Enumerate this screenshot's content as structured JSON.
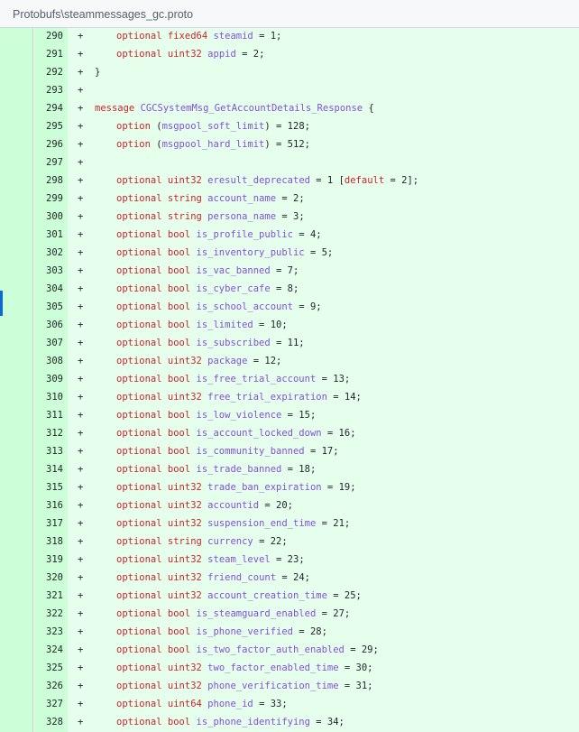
{
  "file": {
    "path": "Protobufs\\steammessages_gc.proto"
  },
  "diff": {
    "marker": "+",
    "lines": [
      {
        "n": "290",
        "indent": true,
        "parts": [
          [
            "kw",
            "optional "
          ],
          [
            "tp",
            "fixed64 "
          ],
          [
            "id",
            "steamid"
          ],
          [
            "p",
            " = 1;"
          ]
        ]
      },
      {
        "n": "291",
        "indent": true,
        "parts": [
          [
            "kw",
            "optional "
          ],
          [
            "tp",
            "uint32 "
          ],
          [
            "id",
            "appid"
          ],
          [
            "p",
            " = 2;"
          ]
        ]
      },
      {
        "n": "292",
        "indent": false,
        "parts": [
          [
            "p",
            "}"
          ]
        ]
      },
      {
        "n": "293",
        "indent": false,
        "parts": []
      },
      {
        "n": "294",
        "indent": false,
        "parts": [
          [
            "kw",
            "message "
          ],
          [
            "id",
            "CGCSystemMsg_GetAccountDetails_Response"
          ],
          [
            "p",
            " {"
          ]
        ]
      },
      {
        "n": "295",
        "indent": true,
        "parts": [
          [
            "kw",
            "option "
          ],
          [
            "p",
            "("
          ],
          [
            "id",
            "msgpool_soft_limit"
          ],
          [
            "p",
            ") = 128;"
          ]
        ]
      },
      {
        "n": "296",
        "indent": true,
        "parts": [
          [
            "kw",
            "option "
          ],
          [
            "p",
            "("
          ],
          [
            "id",
            "msgpool_hard_limit"
          ],
          [
            "p",
            ") = 512;"
          ]
        ]
      },
      {
        "n": "297",
        "indent": false,
        "parts": []
      },
      {
        "n": "298",
        "indent": true,
        "parts": [
          [
            "kw",
            "optional "
          ],
          [
            "tp",
            "uint32 "
          ],
          [
            "id",
            "eresult_deprecated"
          ],
          [
            "p",
            " = 1 ["
          ],
          [
            "kw",
            "default"
          ],
          [
            "p",
            " = 2];"
          ]
        ]
      },
      {
        "n": "299",
        "indent": true,
        "parts": [
          [
            "kw",
            "optional "
          ],
          [
            "tp",
            "string "
          ],
          [
            "id",
            "account_name"
          ],
          [
            "p",
            " = 2;"
          ]
        ]
      },
      {
        "n": "300",
        "indent": true,
        "parts": [
          [
            "kw",
            "optional "
          ],
          [
            "tp",
            "string "
          ],
          [
            "id",
            "persona_name"
          ],
          [
            "p",
            " = 3;"
          ]
        ]
      },
      {
        "n": "301",
        "indent": true,
        "parts": [
          [
            "kw",
            "optional "
          ],
          [
            "tp",
            "bool "
          ],
          [
            "id",
            "is_profile_public"
          ],
          [
            "p",
            " = 4;"
          ]
        ]
      },
      {
        "n": "302",
        "indent": true,
        "parts": [
          [
            "kw",
            "optional "
          ],
          [
            "tp",
            "bool "
          ],
          [
            "id",
            "is_inventory_public"
          ],
          [
            "p",
            " = 5;"
          ]
        ]
      },
      {
        "n": "303",
        "indent": true,
        "parts": [
          [
            "kw",
            "optional "
          ],
          [
            "tp",
            "bool "
          ],
          [
            "id",
            "is_vac_banned"
          ],
          [
            "p",
            " = 7;"
          ]
        ]
      },
      {
        "n": "304",
        "indent": true,
        "parts": [
          [
            "kw",
            "optional "
          ],
          [
            "tp",
            "bool "
          ],
          [
            "id",
            "is_cyber_cafe"
          ],
          [
            "p",
            " = 8;"
          ]
        ]
      },
      {
        "n": "305",
        "indent": true,
        "parts": [
          [
            "kw",
            "optional "
          ],
          [
            "tp",
            "bool "
          ],
          [
            "id",
            "is_school_account"
          ],
          [
            "p",
            " = 9;"
          ]
        ]
      },
      {
        "n": "306",
        "indent": true,
        "parts": [
          [
            "kw",
            "optional "
          ],
          [
            "tp",
            "bool "
          ],
          [
            "id",
            "is_limited"
          ],
          [
            "p",
            " = 10;"
          ]
        ]
      },
      {
        "n": "307",
        "indent": true,
        "parts": [
          [
            "kw",
            "optional "
          ],
          [
            "tp",
            "bool "
          ],
          [
            "id",
            "is_subscribed"
          ],
          [
            "p",
            " = 11;"
          ]
        ]
      },
      {
        "n": "308",
        "indent": true,
        "parts": [
          [
            "kw",
            "optional "
          ],
          [
            "tp",
            "uint32 "
          ],
          [
            "id",
            "package"
          ],
          [
            "p",
            " = 12;"
          ]
        ]
      },
      {
        "n": "309",
        "indent": true,
        "parts": [
          [
            "kw",
            "optional "
          ],
          [
            "tp",
            "bool "
          ],
          [
            "id",
            "is_free_trial_account"
          ],
          [
            "p",
            " = 13;"
          ]
        ]
      },
      {
        "n": "310",
        "indent": true,
        "parts": [
          [
            "kw",
            "optional "
          ],
          [
            "tp",
            "uint32 "
          ],
          [
            "id",
            "free_trial_expiration"
          ],
          [
            "p",
            " = 14;"
          ]
        ]
      },
      {
        "n": "311",
        "indent": true,
        "parts": [
          [
            "kw",
            "optional "
          ],
          [
            "tp",
            "bool "
          ],
          [
            "id",
            "is_low_violence"
          ],
          [
            "p",
            " = 15;"
          ]
        ]
      },
      {
        "n": "312",
        "indent": true,
        "parts": [
          [
            "kw",
            "optional "
          ],
          [
            "tp",
            "bool "
          ],
          [
            "id",
            "is_account_locked_down"
          ],
          [
            "p",
            " = 16;"
          ]
        ]
      },
      {
        "n": "313",
        "indent": true,
        "parts": [
          [
            "kw",
            "optional "
          ],
          [
            "tp",
            "bool "
          ],
          [
            "id",
            "is_community_banned"
          ],
          [
            "p",
            " = 17;"
          ]
        ]
      },
      {
        "n": "314",
        "indent": true,
        "parts": [
          [
            "kw",
            "optional "
          ],
          [
            "tp",
            "bool "
          ],
          [
            "id",
            "is_trade_banned"
          ],
          [
            "p",
            " = 18;"
          ]
        ]
      },
      {
        "n": "315",
        "indent": true,
        "parts": [
          [
            "kw",
            "optional "
          ],
          [
            "tp",
            "uint32 "
          ],
          [
            "id",
            "trade_ban_expiration"
          ],
          [
            "p",
            " = 19;"
          ]
        ]
      },
      {
        "n": "316",
        "indent": true,
        "parts": [
          [
            "kw",
            "optional "
          ],
          [
            "tp",
            "uint32 "
          ],
          [
            "id",
            "accountid"
          ],
          [
            "p",
            " = 20;"
          ]
        ]
      },
      {
        "n": "317",
        "indent": true,
        "parts": [
          [
            "kw",
            "optional "
          ],
          [
            "tp",
            "uint32 "
          ],
          [
            "id",
            "suspension_end_time"
          ],
          [
            "p",
            " = 21;"
          ]
        ]
      },
      {
        "n": "318",
        "indent": true,
        "parts": [
          [
            "kw",
            "optional "
          ],
          [
            "tp",
            "string "
          ],
          [
            "id",
            "currency"
          ],
          [
            "p",
            " = 22;"
          ]
        ]
      },
      {
        "n": "319",
        "indent": true,
        "parts": [
          [
            "kw",
            "optional "
          ],
          [
            "tp",
            "uint32 "
          ],
          [
            "id",
            "steam_level"
          ],
          [
            "p",
            " = 23;"
          ]
        ]
      },
      {
        "n": "320",
        "indent": true,
        "parts": [
          [
            "kw",
            "optional "
          ],
          [
            "tp",
            "uint32 "
          ],
          [
            "id",
            "friend_count"
          ],
          [
            "p",
            " = 24;"
          ]
        ]
      },
      {
        "n": "321",
        "indent": true,
        "parts": [
          [
            "kw",
            "optional "
          ],
          [
            "tp",
            "uint32 "
          ],
          [
            "id",
            "account_creation_time"
          ],
          [
            "p",
            " = 25;"
          ]
        ]
      },
      {
        "n": "322",
        "indent": true,
        "parts": [
          [
            "kw",
            "optional "
          ],
          [
            "tp",
            "bool "
          ],
          [
            "id",
            "is_steamguard_enabled"
          ],
          [
            "p",
            " = 27;"
          ]
        ]
      },
      {
        "n": "323",
        "indent": true,
        "parts": [
          [
            "kw",
            "optional "
          ],
          [
            "tp",
            "bool "
          ],
          [
            "id",
            "is_phone_verified"
          ],
          [
            "p",
            " = 28;"
          ]
        ]
      },
      {
        "n": "324",
        "indent": true,
        "parts": [
          [
            "kw",
            "optional "
          ],
          [
            "tp",
            "bool "
          ],
          [
            "id",
            "is_two_factor_auth_enabled"
          ],
          [
            "p",
            " = 29;"
          ]
        ]
      },
      {
        "n": "325",
        "indent": true,
        "parts": [
          [
            "kw",
            "optional "
          ],
          [
            "tp",
            "uint32 "
          ],
          [
            "id",
            "two_factor_enabled_time"
          ],
          [
            "p",
            " = 30;"
          ]
        ]
      },
      {
        "n": "326",
        "indent": true,
        "parts": [
          [
            "kw",
            "optional "
          ],
          [
            "tp",
            "uint32 "
          ],
          [
            "id",
            "phone_verification_time"
          ],
          [
            "p",
            " = 31;"
          ]
        ]
      },
      {
        "n": "327",
        "indent": true,
        "parts": [
          [
            "kw",
            "optional "
          ],
          [
            "tp",
            "uint64 "
          ],
          [
            "id",
            "phone_id"
          ],
          [
            "p",
            " = 33;"
          ]
        ]
      },
      {
        "n": "328",
        "indent": true,
        "parts": [
          [
            "kw",
            "optional "
          ],
          [
            "tp",
            "bool "
          ],
          [
            "id",
            "is_phone_identifying"
          ],
          [
            "p",
            " = 34;"
          ]
        ]
      }
    ]
  },
  "colors": {
    "added_gutter": "#ccffd8",
    "added_code": "#e6ffec",
    "keyword": "#cf222e",
    "identifier": "#8250df",
    "selection_marker": "#0969da"
  }
}
